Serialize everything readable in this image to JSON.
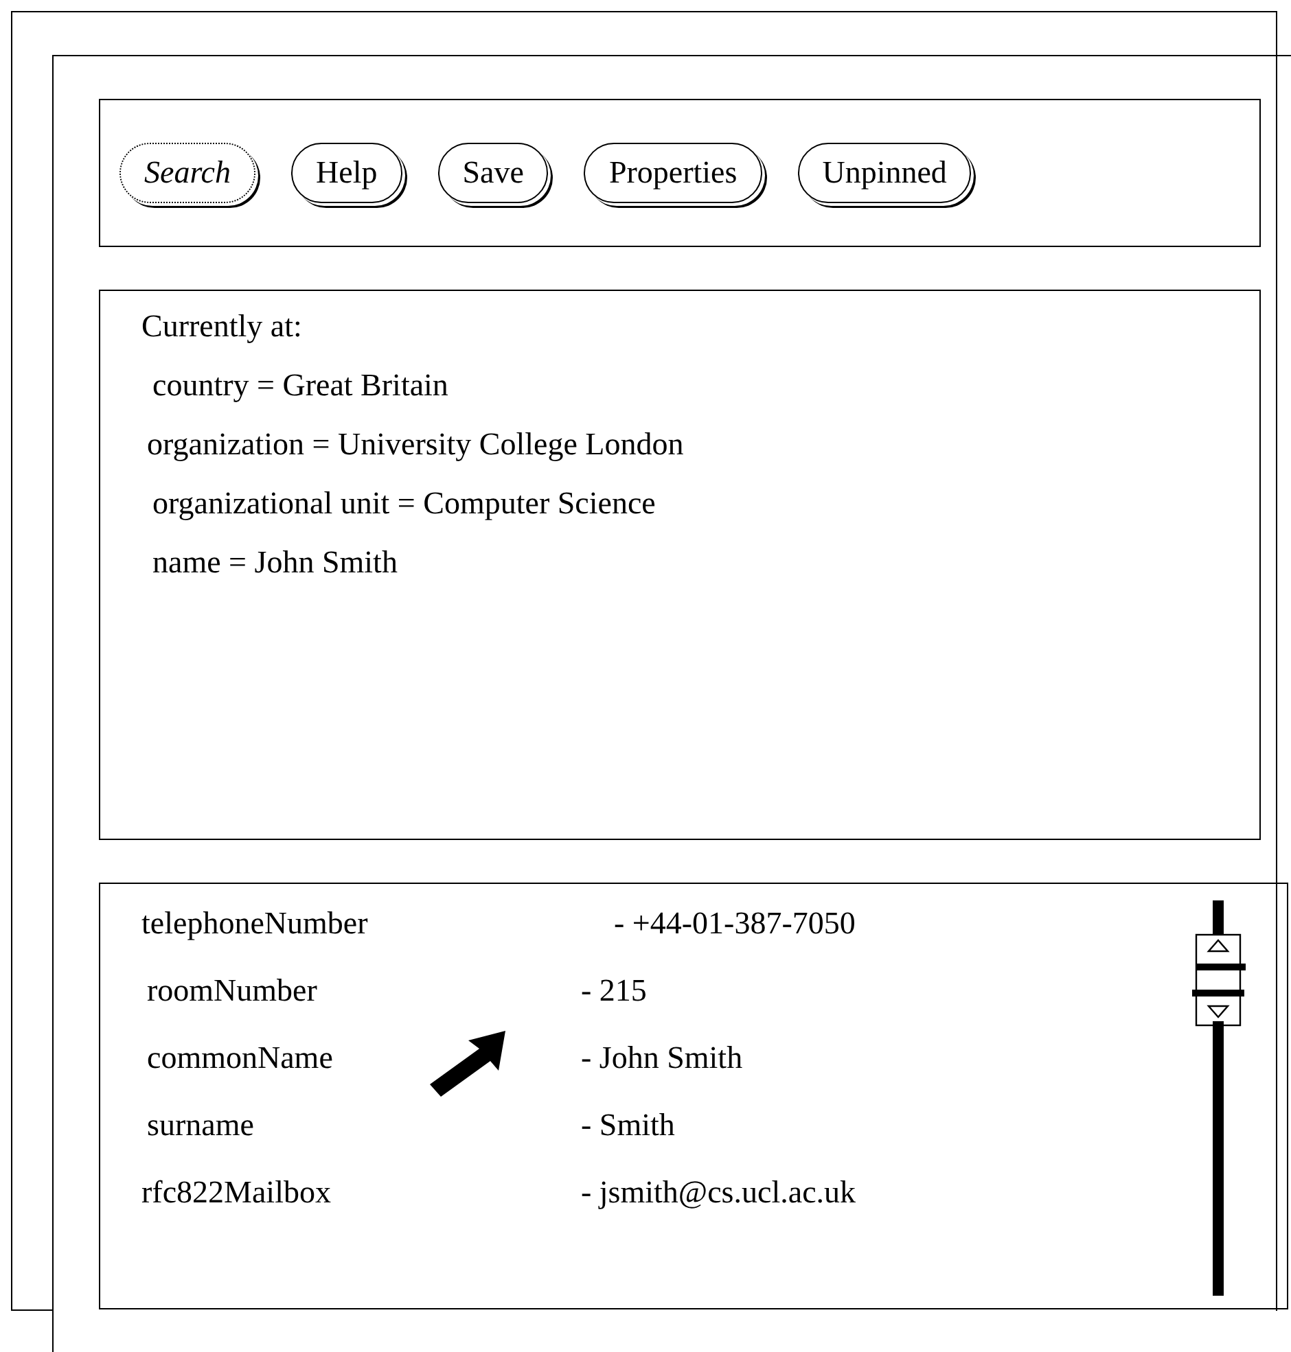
{
  "toolbar": {
    "buttons": [
      {
        "label": "Search",
        "busy": true
      },
      {
        "label": "Help",
        "busy": false
      },
      {
        "label": "Save",
        "busy": false
      },
      {
        "label": "Properties",
        "busy": false
      },
      {
        "label": "Unpinned",
        "busy": false
      }
    ]
  },
  "location": {
    "heading": "Currently at:",
    "lines": [
      "country = Great Britain",
      "organization = University College London",
      "organizational unit = Computer Science",
      "name = John Smith"
    ]
  },
  "attributes": {
    "rows": [
      {
        "name": "telephoneNumber",
        "value": "- +44-01-387-7050"
      },
      {
        "name": "roomNumber",
        "value": "- 215"
      },
      {
        "name": "commonName",
        "value": "- John Smith"
      },
      {
        "name": "surname",
        "value": "- Smith"
      },
      {
        "name": "rfc822Mailbox",
        "value": "- jsmith@cs.ucl.ac.uk"
      }
    ]
  }
}
